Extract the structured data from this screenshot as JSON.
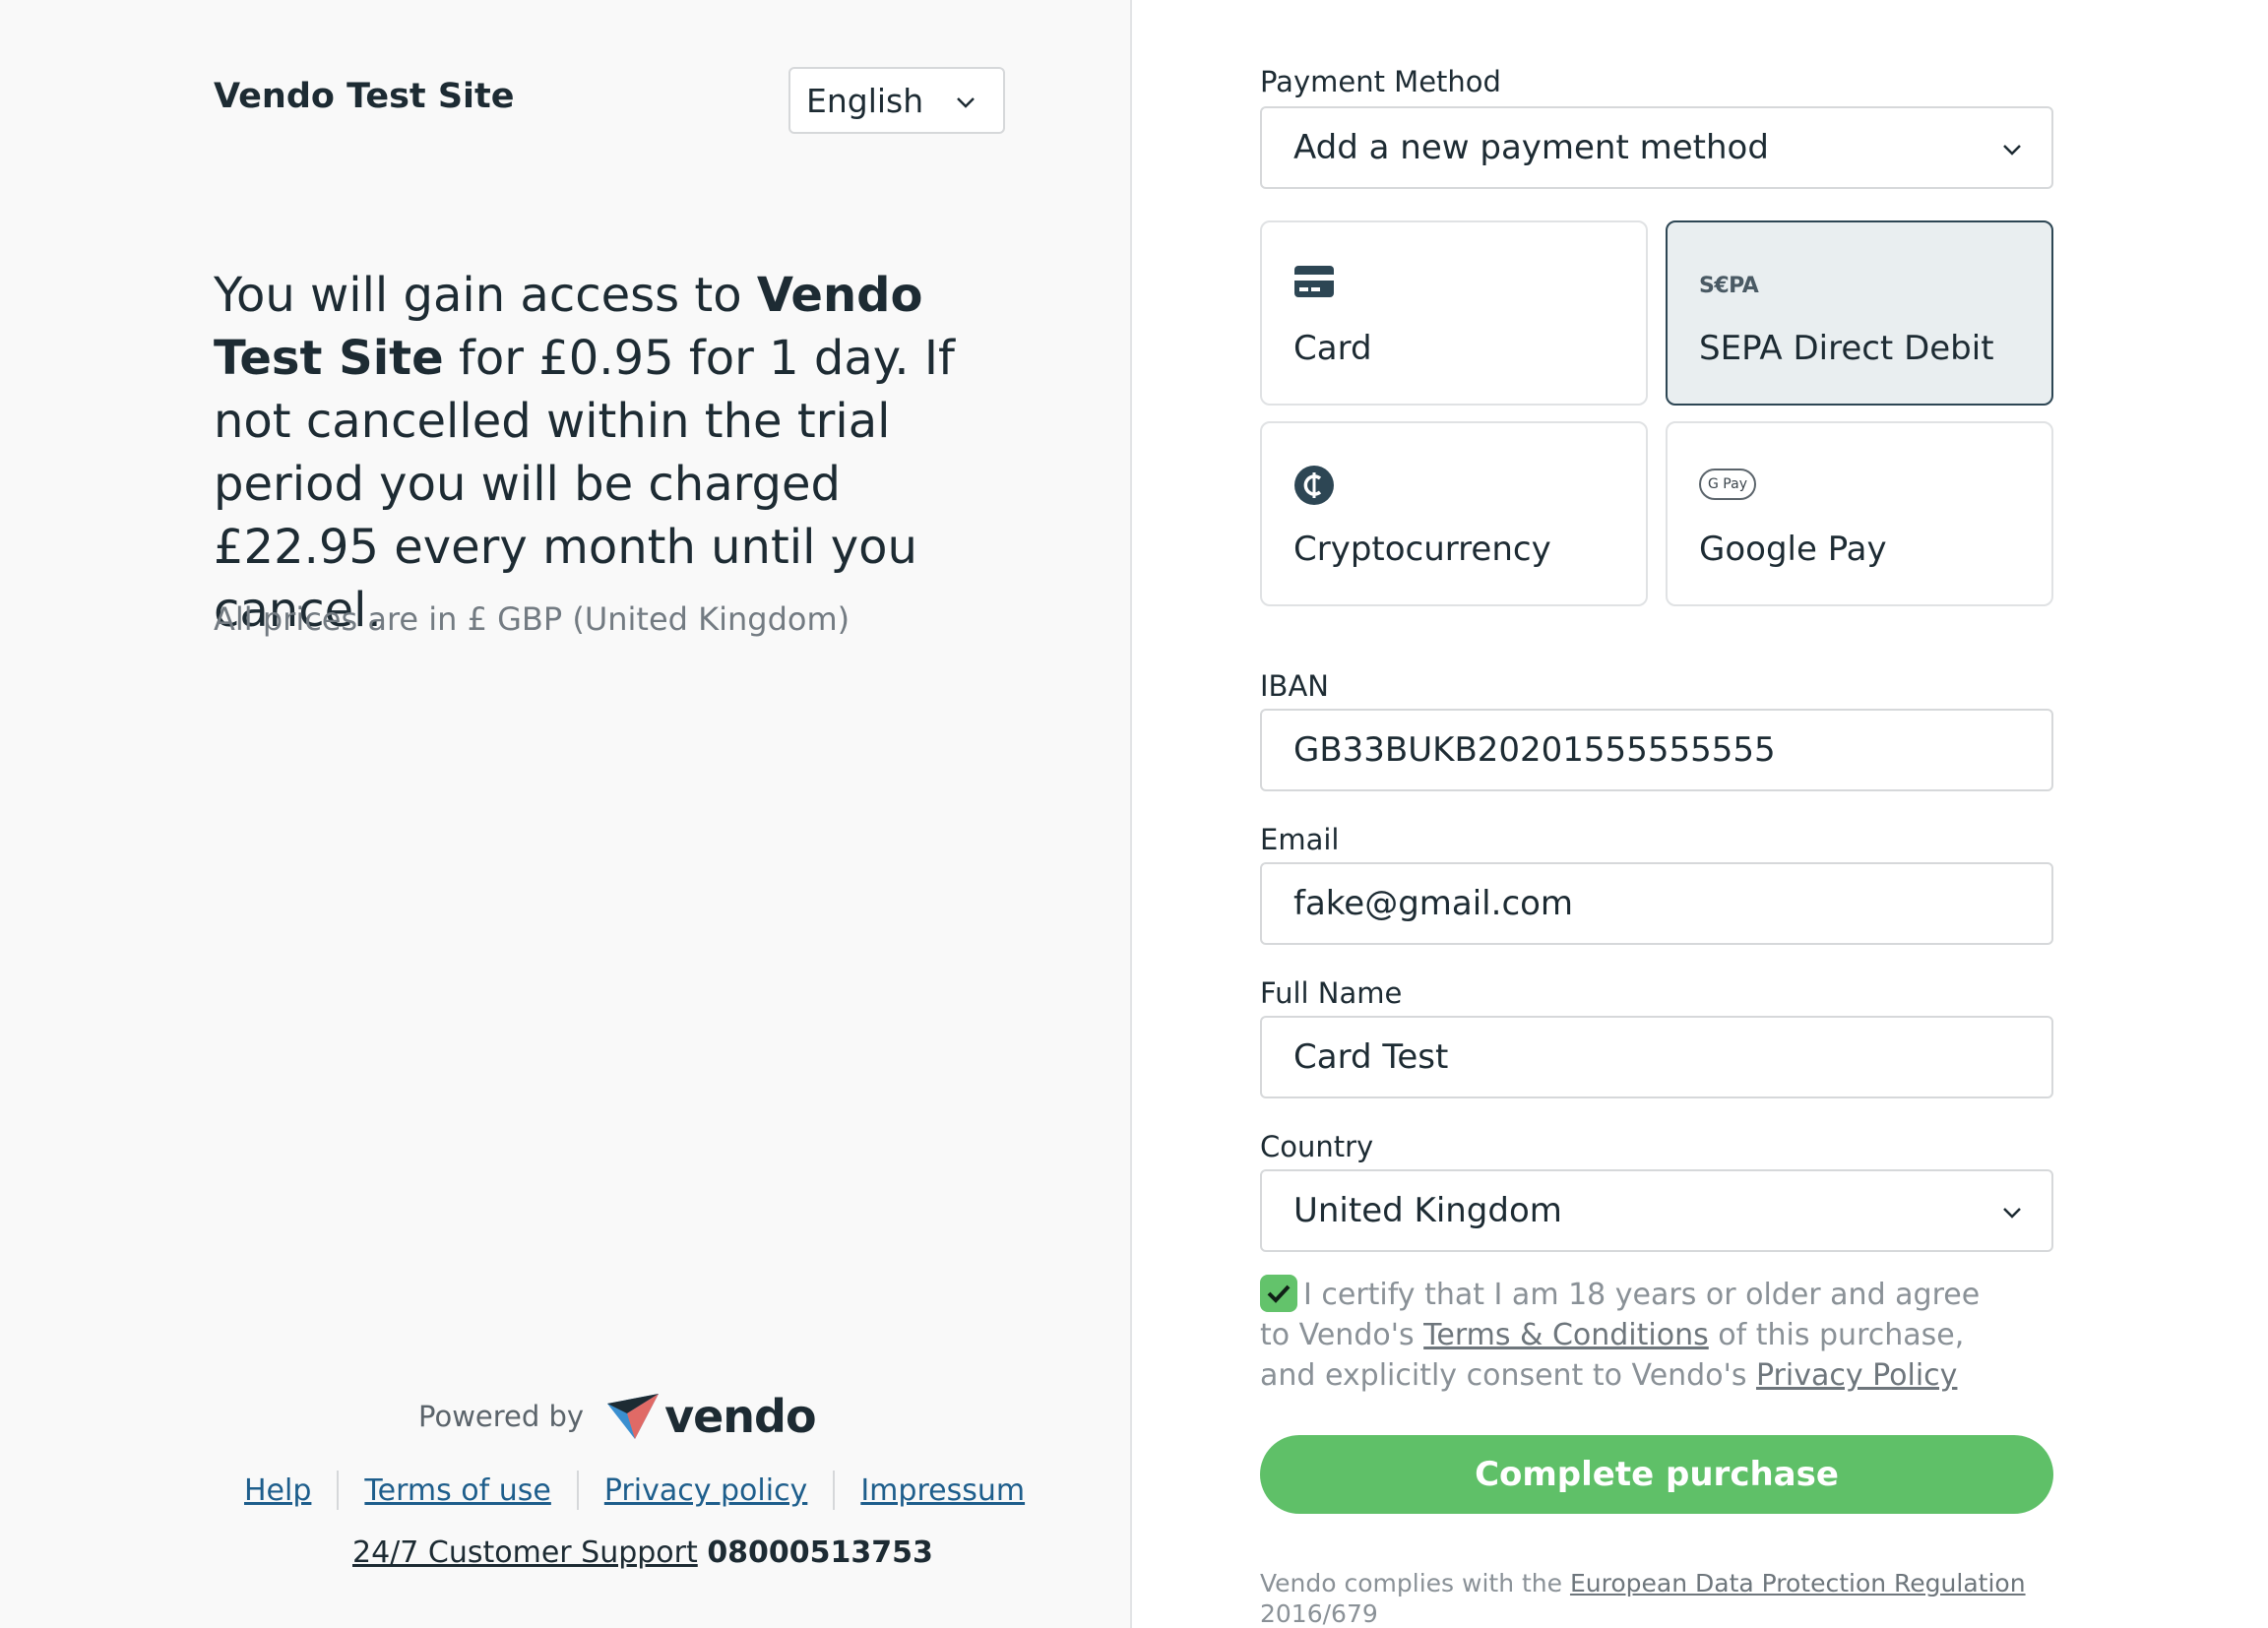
{
  "site": {
    "title": "Vendo Test Site"
  },
  "language": {
    "selected": "English"
  },
  "offer": {
    "part1": "You will gain access to ",
    "site_bold": "Vendo Test Site",
    "part2": " for £0.95 for 1 day. If not cancelled within the trial period you will be charged £22.95 every month until you cancel."
  },
  "prices_note": "All prices are in £ GBP (United Kingdom)",
  "powered": {
    "label": "Powered by",
    "brand": "vendo"
  },
  "footer": {
    "links": [
      "Help",
      "Terms of use",
      "Privacy policy",
      "Impressum"
    ],
    "support_label": "24/7 Customer Support",
    "support_phone": "08000513753"
  },
  "payment": {
    "method_label": "Payment Method",
    "method_value": "Add a new payment method",
    "options": [
      {
        "label": "Card",
        "icon": "card-icon",
        "selected": false
      },
      {
        "label": "SEPA Direct Debit",
        "icon": "sepa-icon",
        "icon_text": "S€PA",
        "selected": true
      },
      {
        "label": "Cryptocurrency",
        "icon": "crypto-icon",
        "selected": false
      },
      {
        "label": "Google Pay",
        "icon": "google-pay-icon",
        "icon_text": "G Pay",
        "selected": false
      }
    ]
  },
  "form": {
    "iban": {
      "label": "IBAN",
      "value": "GB33BUKB20201555555555"
    },
    "email": {
      "label": "Email",
      "value": "fake@gmail.com"
    },
    "full_name": {
      "label": "Full Name",
      "value": "Card Test"
    },
    "country": {
      "label": "Country",
      "value": "United Kingdom"
    }
  },
  "consent": {
    "checked": true,
    "text1": "I certify that I am 18 years or older and agree to Vendo's ",
    "terms_link": "Terms & Conditions",
    "text2": " of this purchase, and explicitly consent to Vendo's ",
    "privacy_link": "Privacy Policy"
  },
  "submit": {
    "label": "Complete purchase"
  },
  "gdpr": {
    "text": "Vendo complies with the ",
    "link": "European Data Protection Regulation",
    "text2": " 2016/679"
  },
  "colors": {
    "accent_green": "#5fc068",
    "text_dark": "#1d2b33",
    "link_blue": "#1e5e8c",
    "selected_bg": "#e9eef0"
  }
}
